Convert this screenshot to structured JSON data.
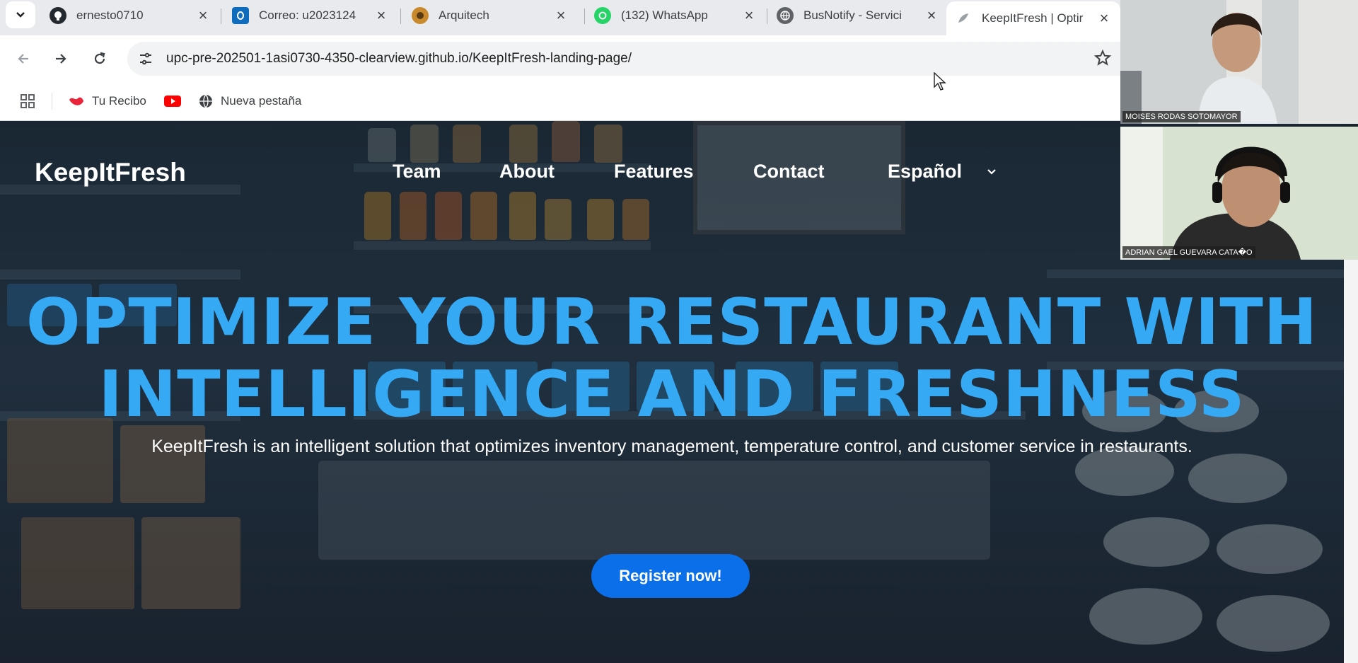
{
  "tabs": [
    {
      "label": "ernesto0710",
      "icon": "github-icon"
    },
    {
      "label": "Correo: u2023124",
      "icon": "outlook-icon"
    },
    {
      "label": "Arquitech",
      "icon": "arquitech-icon"
    },
    {
      "label": "(132) WhatsApp",
      "icon": "whatsapp-icon"
    },
    {
      "label": "BusNotify - Servici",
      "icon": "globe-icon"
    },
    {
      "label": "KeepItFresh | Optir",
      "icon": "keepitfresh-icon",
      "active": true
    }
  ],
  "toolbar": {
    "url": "upc-pre-202501-1asi0730-4350-clearview.github.io/KeepItFresh-landing-page/"
  },
  "bookmarks": [
    {
      "label": "Tu Recibo",
      "icon": "turecibo-icon"
    },
    {
      "label": "",
      "icon": "youtube-icon"
    },
    {
      "label": "Nueva pestaña",
      "icon": "globe-icon"
    }
  ],
  "site": {
    "logo": "KeepItFresh",
    "nav": [
      "Team",
      "About",
      "Features",
      "Contact"
    ],
    "language": "Español"
  },
  "hero": {
    "line1": "OPTIMIZE YOUR RESTAURANT WITH",
    "line2": "INTELLIGENCE AND FRESHNESS",
    "subtitle": "KeepItFresh is an intelligent solution that optimizes inventory management, temperature control, and customer service in restaurants.",
    "cta": "Register now!"
  },
  "call": {
    "participants": [
      "MOISES RODAS SOTOMAYOR",
      "ADRIAN GAEL GUEVARA CATA�O"
    ]
  },
  "colors": {
    "accent": "#36a9f5",
    "cta": "#0a6fe8"
  }
}
